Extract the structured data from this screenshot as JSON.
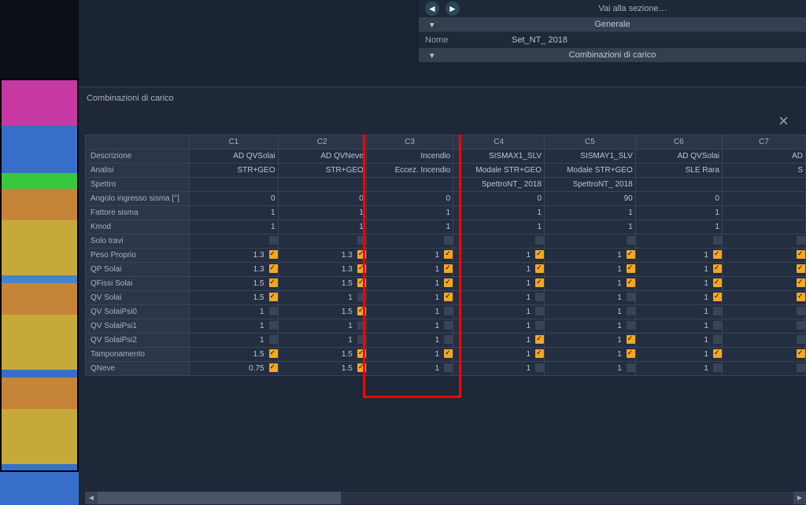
{
  "top_panel": {
    "goto_label": "Vai alla sezione…",
    "section_general": "Generale",
    "name_label": "Nome",
    "name_value": "Set_NT_ 2018",
    "section_combos": "Combinazioni di carico"
  },
  "window": {
    "title": "Combinazioni di carico"
  },
  "columns": [
    "C1",
    "C2",
    "C3",
    "C4",
    "C5",
    "C6",
    "C7"
  ],
  "row_labels": {
    "descr": "Descrizione",
    "analisi": "Analisi",
    "spettro": "Spettro",
    "angolo": "Angolo ingresso sisma [°]",
    "fattore": "Fattore sisma",
    "kmod": "Kmod",
    "solotravi": "Solo travi",
    "peso": "Peso Proprio",
    "qp": "QP Solai",
    "qfissi": "QFissi Solai",
    "qv": "QV Solai",
    "qvpsi0": "QV SolaiPsi0",
    "qvpsi1": "QV SolaiPsi1",
    "qvpsi2": "QV SolaiPsi2",
    "tamp": "Tamponamento",
    "qneve": "QNeve"
  },
  "text_rows": {
    "descr": [
      "AD QVSolai",
      "AD QVNeve",
      "Incendio",
      "SISMAX1_SLV",
      "SISMAY1_SLV",
      "AD QVSolai",
      "AD"
    ],
    "analisi": [
      "STR+GEO",
      "STR+GEO",
      "Eccez. Incendio",
      "Modale STR+GEO",
      "Modale STR+GEO",
      "SLE Rara",
      "S"
    ],
    "spettro": [
      "",
      "",
      "",
      "SpettroNT_ 2018",
      "SpettroNT_ 2018",
      "",
      ""
    ],
    "angolo": [
      "0",
      "0",
      "0",
      "0",
      "90",
      "0",
      ""
    ],
    "fattore": [
      "1",
      "1",
      "1",
      "1",
      "1",
      "1",
      ""
    ],
    "kmod": [
      "1",
      "1",
      "1",
      "1",
      "1",
      "1",
      ""
    ]
  },
  "check_rows": {
    "solotravi": {
      "vals": [
        "",
        "",
        "",
        "",
        "",
        "",
        ""
      ],
      "chk": [
        false,
        false,
        false,
        false,
        false,
        false,
        false
      ]
    },
    "peso": {
      "vals": [
        "1.3",
        "1.3",
        "1",
        "1",
        "1",
        "1",
        ""
      ],
      "chk": [
        true,
        true,
        true,
        true,
        true,
        true,
        true
      ]
    },
    "qp": {
      "vals": [
        "1.3",
        "1.3",
        "1",
        "1",
        "1",
        "1",
        ""
      ],
      "chk": [
        true,
        true,
        true,
        true,
        true,
        true,
        true
      ]
    },
    "qfissi": {
      "vals": [
        "1.5",
        "1.5",
        "1",
        "1",
        "1",
        "1",
        ""
      ],
      "chk": [
        true,
        true,
        true,
        true,
        true,
        true,
        true
      ]
    },
    "qv": {
      "vals": [
        "1.5",
        "1",
        "1",
        "1",
        "1",
        "1",
        ""
      ],
      "chk": [
        true,
        false,
        true,
        false,
        false,
        true,
        true
      ]
    },
    "qvpsi0": {
      "vals": [
        "1",
        "1.5",
        "1",
        "1",
        "1",
        "1",
        ""
      ],
      "chk": [
        false,
        true,
        false,
        false,
        false,
        false,
        false
      ]
    },
    "qvpsi1": {
      "vals": [
        "1",
        "1",
        "1",
        "1",
        "1",
        "1",
        ""
      ],
      "chk": [
        false,
        false,
        false,
        false,
        false,
        false,
        false
      ]
    },
    "qvpsi2": {
      "vals": [
        "1",
        "1",
        "1",
        "1",
        "1",
        "1",
        ""
      ],
      "chk": [
        false,
        false,
        false,
        true,
        true,
        false,
        false
      ]
    },
    "tamp": {
      "vals": [
        "1.5",
        "1.5",
        "1",
        "1",
        "1",
        "1",
        ""
      ],
      "chk": [
        true,
        true,
        true,
        true,
        true,
        true,
        true
      ]
    },
    "qneve": {
      "vals": [
        "0.75",
        "1.5",
        "1",
        "1",
        "1",
        "1",
        ""
      ],
      "chk": [
        true,
        true,
        false,
        false,
        false,
        false,
        false
      ]
    }
  }
}
